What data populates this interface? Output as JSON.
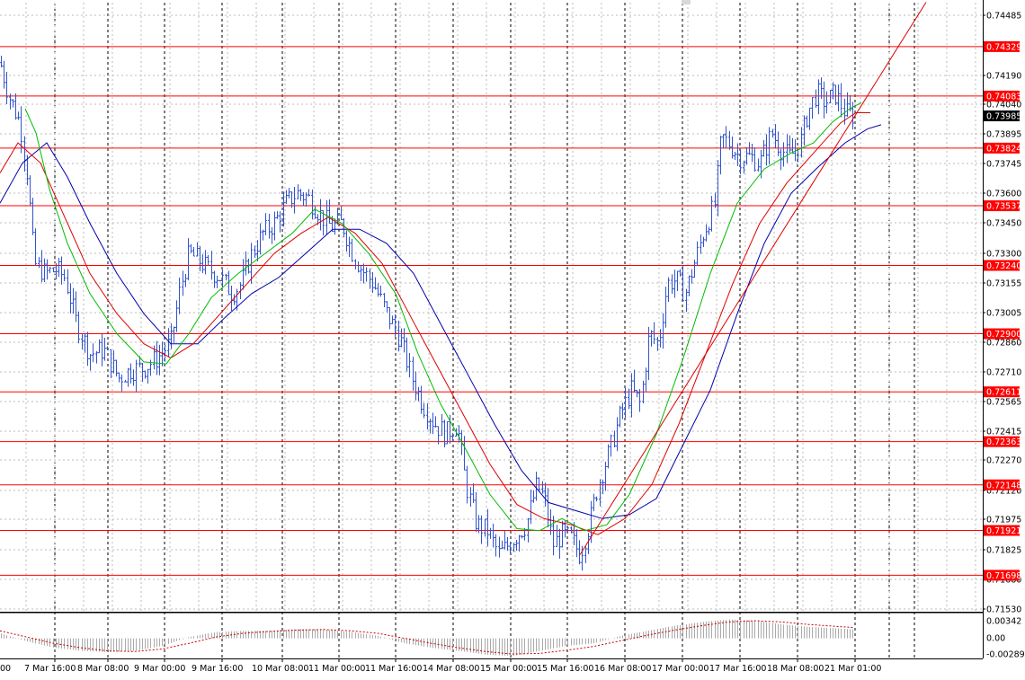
{
  "chart_data": {
    "type": "candlestick",
    "instrument_note": "",
    "title": "",
    "y_ticks": [
      "0.74485",
      "0.74190",
      "0.74040",
      "0.73895",
      "0.73745",
      "0.73600",
      "0.73450",
      "0.73300",
      "0.73155",
      "0.73005",
      "0.72860",
      "0.72710",
      "0.72565",
      "0.72415",
      "0.72270",
      "0.72120",
      "0.71975",
      "0.71825",
      "0.71680",
      "0.71530"
    ],
    "ylim": [
      0.715,
      0.7456
    ],
    "x_ticks": [
      "7 Mar 16:00",
      "8 Mar 08:00",
      "9 Mar 00:00",
      "9 Mar 16:00",
      "10 Mar 08:00",
      "11 Mar 00:00",
      "11 Mar 16:00",
      "14 Mar 08:00",
      "15 Mar 00:00",
      "15 Mar 16:00",
      "16 Mar 08:00",
      "17 Mar 00:00",
      "17 Mar 16:00",
      "18 Mar 08:00",
      "21 Mar 01:00"
    ],
    "edge_tick_partial": "00",
    "levels": [
      {
        "label": "0.74329",
        "value": 0.74329
      },
      {
        "label": "0.74083",
        "value": 0.74083
      },
      {
        "label": "0.73824",
        "value": 0.73824
      },
      {
        "label": "0.73537",
        "value": 0.73537
      },
      {
        "label": "0.73240",
        "value": 0.7324
      },
      {
        "label": "0.72900",
        "value": 0.729
      },
      {
        "label": "0.72611",
        "value": 0.72611
      },
      {
        "label": "0.72363",
        "value": 0.72363
      },
      {
        "label": "0.72148",
        "value": 0.72148
      },
      {
        "label": "0.71921",
        "value": 0.71921
      },
      {
        "label": "0.71698",
        "value": 0.71698
      }
    ],
    "current_price": "0.73985",
    "price_path": [
      [
        0,
        0.7425
      ],
      [
        10,
        0.7408
      ],
      [
        22,
        0.7395
      ],
      [
        30,
        0.737
      ],
      [
        38,
        0.7325
      ],
      [
        50,
        0.732
      ],
      [
        62,
        0.7322
      ],
      [
        72,
        0.7318
      ],
      [
        85,
        0.7295
      ],
      [
        100,
        0.728
      ],
      [
        115,
        0.7282
      ],
      [
        132,
        0.7268
      ],
      [
        145,
        0.7272
      ],
      [
        160,
        0.7273
      ],
      [
        175,
        0.7278
      ],
      [
        190,
        0.7286
      ],
      [
        200,
        0.7312
      ],
      [
        210,
        0.733
      ],
      [
        220,
        0.7327
      ],
      [
        232,
        0.7322
      ],
      [
        245,
        0.7318
      ],
      [
        258,
        0.731
      ],
      [
        268,
        0.7315
      ],
      [
        280,
        0.733
      ],
      [
        292,
        0.734
      ],
      [
        305,
        0.7345
      ],
      [
        318,
        0.7355
      ],
      [
        330,
        0.736
      ],
      [
        342,
        0.7358
      ],
      [
        355,
        0.735
      ],
      [
        368,
        0.7343
      ],
      [
        380,
        0.7345
      ],
      [
        392,
        0.733
      ],
      [
        402,
        0.7322
      ],
      [
        415,
        0.7315
      ],
      [
        430,
        0.73
      ],
      [
        445,
        0.7287
      ],
      [
        458,
        0.7268
      ],
      [
        470,
        0.7255
      ],
      [
        482,
        0.7246
      ],
      [
        495,
        0.724
      ],
      [
        508,
        0.7245
      ],
      [
        518,
        0.7215
      ],
      [
        530,
        0.7195
      ],
      [
        542,
        0.7192
      ],
      [
        555,
        0.718
      ],
      [
        565,
        0.7185
      ],
      [
        575,
        0.719
      ],
      [
        585,
        0.7195
      ],
      [
        597,
        0.7215
      ],
      [
        605,
        0.7208
      ],
      [
        615,
        0.7185
      ],
      [
        625,
        0.719
      ],
      [
        635,
        0.7188
      ],
      [
        645,
        0.718
      ],
      [
        655,
        0.7195
      ],
      [
        665,
        0.7215
      ],
      [
        678,
        0.7232
      ],
      [
        690,
        0.725
      ],
      [
        702,
        0.7262
      ],
      [
        712,
        0.7255
      ],
      [
        722,
        0.729
      ],
      [
        732,
        0.7285
      ],
      [
        742,
        0.7315
      ],
      [
        752,
        0.7317
      ],
      [
        762,
        0.731
      ],
      [
        772,
        0.7325
      ],
      [
        782,
        0.734
      ],
      [
        795,
        0.7355
      ],
      [
        802,
        0.7388
      ],
      [
        812,
        0.7384
      ],
      [
        822,
        0.7378
      ],
      [
        835,
        0.7378
      ],
      [
        845,
        0.7375
      ],
      [
        858,
        0.739
      ],
      [
        868,
        0.7382
      ],
      [
        878,
        0.7378
      ],
      [
        890,
        0.7385
      ],
      [
        898,
        0.74
      ],
      [
        908,
        0.741
      ],
      [
        918,
        0.7405
      ],
      [
        928,
        0.741
      ],
      [
        940,
        0.74
      ],
      [
        950,
        0.73985
      ]
    ],
    "ma_green": [
      [
        28,
        0.7402
      ],
      [
        40,
        0.739
      ],
      [
        55,
        0.7362
      ],
      [
        75,
        0.7335
      ],
      [
        100,
        0.731
      ],
      [
        130,
        0.729
      ],
      [
        160,
        0.7276
      ],
      [
        185,
        0.7275
      ],
      [
        210,
        0.729
      ],
      [
        235,
        0.7308
      ],
      [
        265,
        0.732
      ],
      [
        295,
        0.733
      ],
      [
        325,
        0.734
      ],
      [
        350,
        0.7352
      ],
      [
        380,
        0.7345
      ],
      [
        410,
        0.733
      ],
      [
        440,
        0.731
      ],
      [
        465,
        0.728
      ],
      [
        490,
        0.7255
      ],
      [
        515,
        0.7235
      ],
      [
        545,
        0.721
      ],
      [
        575,
        0.7193
      ],
      [
        600,
        0.7192
      ],
      [
        625,
        0.7198
      ],
      [
        650,
        0.7192
      ],
      [
        675,
        0.7195
      ],
      [
        700,
        0.721
      ],
      [
        730,
        0.724
      ],
      [
        760,
        0.7278
      ],
      [
        790,
        0.732
      ],
      [
        820,
        0.7355
      ],
      [
        850,
        0.7372
      ],
      [
        880,
        0.738
      ],
      [
        905,
        0.7385
      ],
      [
        925,
        0.7395
      ],
      [
        945,
        0.7402
      ],
      [
        958,
        0.7405
      ]
    ],
    "ma_red": [
      [
        0,
        0.737
      ],
      [
        20,
        0.7385
      ],
      [
        45,
        0.7375
      ],
      [
        70,
        0.735
      ],
      [
        100,
        0.732
      ],
      [
        130,
        0.73
      ],
      [
        160,
        0.7285
      ],
      [
        190,
        0.7278
      ],
      [
        215,
        0.7285
      ],
      [
        245,
        0.73
      ],
      [
        275,
        0.7315
      ],
      [
        305,
        0.733
      ],
      [
        335,
        0.734
      ],
      [
        365,
        0.7348
      ],
      [
        395,
        0.734
      ],
      [
        425,
        0.7325
      ],
      [
        455,
        0.73
      ],
      [
        485,
        0.7275
      ],
      [
        515,
        0.725
      ],
      [
        545,
        0.7225
      ],
      [
        575,
        0.7205
      ],
      [
        605,
        0.7198
      ],
      [
        635,
        0.7195
      ],
      [
        665,
        0.719
      ],
      [
        695,
        0.7198
      ],
      [
        725,
        0.7215
      ],
      [
        755,
        0.7245
      ],
      [
        785,
        0.728
      ],
      [
        815,
        0.7315
      ],
      [
        845,
        0.7345
      ],
      [
        875,
        0.7365
      ],
      [
        905,
        0.738
      ],
      [
        935,
        0.7395
      ],
      [
        952,
        0.74
      ],
      [
        968,
        0.74
      ]
    ],
    "ma_blue": [
      [
        0,
        0.7355
      ],
      [
        25,
        0.7375
      ],
      [
        52,
        0.7385
      ],
      [
        75,
        0.7368
      ],
      [
        100,
        0.7345
      ],
      [
        130,
        0.732
      ],
      [
        160,
        0.73
      ],
      [
        190,
        0.7285
      ],
      [
        220,
        0.7285
      ],
      [
        250,
        0.7298
      ],
      [
        280,
        0.731
      ],
      [
        310,
        0.7318
      ],
      [
        340,
        0.733
      ],
      [
        370,
        0.7342
      ],
      [
        400,
        0.7342
      ],
      [
        430,
        0.7335
      ],
      [
        460,
        0.732
      ],
      [
        490,
        0.7295
      ],
      [
        520,
        0.727
      ],
      [
        550,
        0.7245
      ],
      [
        580,
        0.7222
      ],
      [
        610,
        0.7206
      ],
      [
        640,
        0.7202
      ],
      [
        670,
        0.7198
      ],
      [
        700,
        0.72
      ],
      [
        730,
        0.7208
      ],
      [
        760,
        0.7235
      ],
      [
        790,
        0.7262
      ],
      [
        820,
        0.73
      ],
      [
        850,
        0.7335
      ],
      [
        880,
        0.736
      ],
      [
        910,
        0.7373
      ],
      [
        940,
        0.7385
      ],
      [
        965,
        0.7392
      ],
      [
        980,
        0.7394
      ]
    ],
    "trendline": [
      [
        645,
        0.718
      ],
      [
        1030,
        0.7455
      ]
    ],
    "indicator": {
      "type": "macd",
      "y_ticks": [
        "0.00342",
        "0.00",
        "-0.002894"
      ],
      "ylim": [
        -0.0032,
        0.0038
      ],
      "histogram": [
        [
          0,
          0.0008
        ],
        [
          30,
          -0.0005
        ],
        [
          60,
          -0.0015
        ],
        [
          90,
          -0.002
        ],
        [
          120,
          -0.0022
        ],
        [
          150,
          -0.002
        ],
        [
          180,
          -0.0012
        ],
        [
          210,
          0.0002
        ],
        [
          240,
          0.001
        ],
        [
          270,
          0.0012
        ],
        [
          300,
          0.0012
        ],
        [
          330,
          0.0015
        ],
        [
          360,
          0.0014
        ],
        [
          390,
          0.001
        ],
        [
          420,
          0.0004
        ],
        [
          450,
          -0.0008
        ],
        [
          480,
          -0.0015
        ],
        [
          510,
          -0.002
        ],
        [
          540,
          -0.0026
        ],
        [
          570,
          -0.0028
        ],
        [
          600,
          -0.002
        ],
        [
          630,
          -0.0012
        ],
        [
          660,
          -0.0008
        ],
        [
          690,
          0.0004
        ],
        [
          720,
          0.0012
        ],
        [
          750,
          0.002
        ],
        [
          780,
          0.0026
        ],
        [
          810,
          0.003
        ],
        [
          840,
          0.0028
        ],
        [
          870,
          0.0022
        ],
        [
          900,
          0.0018
        ],
        [
          930,
          0.0016
        ],
        [
          950,
          0.0014
        ]
      ],
      "signal": [
        [
          0,
          0.0012
        ],
        [
          30,
          0.0002
        ],
        [
          60,
          -0.0008
        ],
        [
          90,
          -0.0015
        ],
        [
          120,
          -0.002
        ],
        [
          150,
          -0.0021
        ],
        [
          180,
          -0.0017
        ],
        [
          210,
          -0.0008
        ],
        [
          240,
          0.0002
        ],
        [
          270,
          0.0008
        ],
        [
          300,
          0.0011
        ],
        [
          330,
          0.0013
        ],
        [
          360,
          0.0014
        ],
        [
          390,
          0.0012
        ],
        [
          420,
          0.0008
        ],
        [
          450,
          0.0
        ],
        [
          480,
          -0.0008
        ],
        [
          510,
          -0.0015
        ],
        [
          540,
          -0.0021
        ],
        [
          570,
          -0.0025
        ],
        [
          600,
          -0.0024
        ],
        [
          630,
          -0.0019
        ],
        [
          660,
          -0.0013
        ],
        [
          690,
          -0.0004
        ],
        [
          720,
          0.0005
        ],
        [
          750,
          0.0013
        ],
        [
          780,
          0.002
        ],
        [
          810,
          0.0026
        ],
        [
          840,
          0.0028
        ],
        [
          870,
          0.0026
        ],
        [
          900,
          0.0022
        ],
        [
          930,
          0.0019
        ],
        [
          950,
          0.0017
        ]
      ]
    },
    "colors": {
      "candle": "#3355cc",
      "ma_green": "#00bb00",
      "ma_red": "#dd0000",
      "ma_blue": "#0000aa",
      "level_line": "#ff0000",
      "level_label_bg": "#ff0000",
      "current_label_bg": "#000000",
      "grid": "#bbbbbb",
      "indicator_hist": "#aaaaaa",
      "indicator_signal": "#cc0000"
    },
    "grid": true
  }
}
